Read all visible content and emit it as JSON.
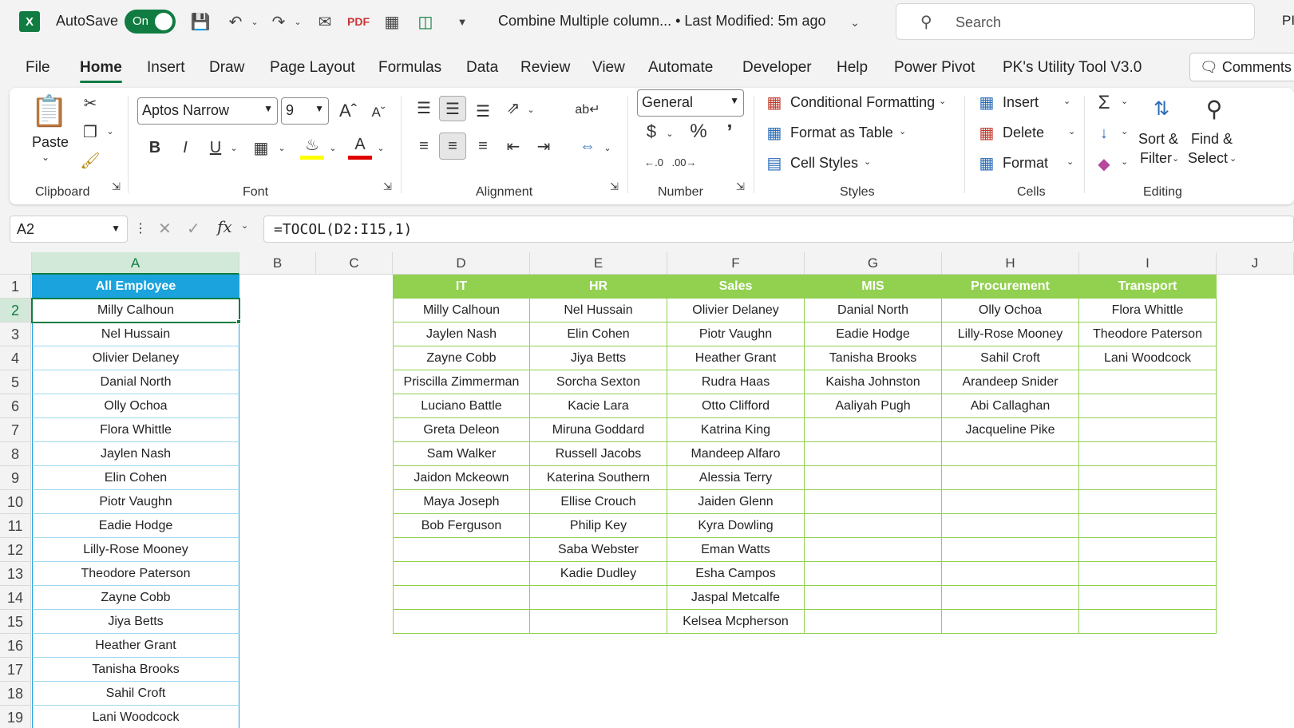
{
  "titlebar": {
    "autosave_label": "AutoSave",
    "autosave_state": "On",
    "doc_title": "Combine Multiple column...  •  Last Modified: 5m ago",
    "search_placeholder": "Search",
    "user_initials": "PI"
  },
  "tabs": [
    "File",
    "Home",
    "Insert",
    "Draw",
    "Page Layout",
    "Formulas",
    "Data",
    "Review",
    "View",
    "Automate",
    "Developer",
    "Help",
    "Power Pivot",
    "PK's Utility Tool V3.0"
  ],
  "active_tab": "Home",
  "comments_label": "Comments",
  "ribbon": {
    "clipboard": {
      "label": "Clipboard",
      "paste": "Paste"
    },
    "font": {
      "label": "Font",
      "name": "Aptos Narrow",
      "size": "9"
    },
    "alignment": {
      "label": "Alignment"
    },
    "number": {
      "label": "Number",
      "format": "General"
    },
    "styles": {
      "label": "Styles",
      "conditional": "Conditional Formatting",
      "format_table": "Format as Table",
      "cell_styles": "Cell Styles"
    },
    "cells": {
      "label": "Cells",
      "insert": "Insert",
      "delete": "Delete",
      "format": "Format"
    },
    "editing": {
      "label": "Editing",
      "sort1": "Sort &",
      "sort2": "Filter",
      "find1": "Find &",
      "find2": "Select"
    }
  },
  "formula_bar": {
    "name_box": "A2",
    "formula": "=TOCOL(D2:I15,1)"
  },
  "columns": [
    "A",
    "B",
    "C",
    "D",
    "E",
    "F",
    "G",
    "H",
    "I",
    "J"
  ],
  "rows": [
    "1",
    "2",
    "3",
    "4",
    "5",
    "6",
    "7",
    "8",
    "9",
    "10",
    "11",
    "12",
    "13",
    "14",
    "15",
    "16",
    "17",
    "18",
    "19"
  ],
  "all_employee": {
    "header": "All Employee",
    "values": [
      "Milly Calhoun",
      "Nel Hussain",
      "Olivier Delaney",
      "Danial North",
      "Olly Ochoa",
      "Flora Whittle",
      "Jaylen Nash",
      "Elin Cohen",
      "Piotr Vaughn",
      "Eadie Hodge",
      "Lilly-Rose Mooney",
      "Theodore Paterson",
      "Zayne Cobb",
      "Jiya Betts",
      "Heather Grant",
      "Tanisha Brooks",
      "Sahil Croft",
      "Lani Woodcock"
    ]
  },
  "dept_table": {
    "headers": [
      "IT",
      "HR",
      "Sales",
      "MIS",
      "Procurement",
      "Transport"
    ],
    "rows": [
      [
        "Milly Calhoun",
        "Nel Hussain",
        "Olivier Delaney",
        "Danial North",
        "Olly Ochoa",
        "Flora Whittle"
      ],
      [
        "Jaylen Nash",
        "Elin Cohen",
        "Piotr Vaughn",
        "Eadie Hodge",
        "Lilly-Rose Mooney",
        "Theodore Paterson"
      ],
      [
        "Zayne Cobb",
        "Jiya Betts",
        "Heather Grant",
        "Tanisha Brooks",
        "Sahil Croft",
        "Lani Woodcock"
      ],
      [
        "Priscilla Zimmerman",
        "Sorcha Sexton",
        "Rudra Haas",
        "Kaisha Johnston",
        "Arandeep Snider",
        ""
      ],
      [
        "Luciano Battle",
        "Kacie Lara",
        "Otto Clifford",
        "Aaliyah Pugh",
        "Abi Callaghan",
        ""
      ],
      [
        "Greta Deleon",
        "Miruna Goddard",
        "Katrina King",
        "",
        "Jacqueline Pike",
        ""
      ],
      [
        "Sam Walker",
        "Russell Jacobs",
        "Mandeep Alfaro",
        "",
        "",
        ""
      ],
      [
        "Jaidon Mckeown",
        "Katerina Southern",
        "Alessia Terry",
        "",
        "",
        ""
      ],
      [
        "Maya Joseph",
        "Ellise Crouch",
        "Jaiden Glenn",
        "",
        "",
        ""
      ],
      [
        "Bob Ferguson",
        "Philip Key",
        "Kyra Dowling",
        "",
        "",
        ""
      ],
      [
        "",
        "Saba Webster",
        "Eman Watts",
        "",
        "",
        ""
      ],
      [
        "",
        "Kadie Dudley",
        "Esha Campos",
        "",
        "",
        ""
      ],
      [
        "",
        "",
        "Jaspal Metcalfe",
        "",
        "",
        ""
      ],
      [
        "",
        "",
        "Kelsea Mcpherson",
        "",
        "",
        ""
      ]
    ]
  },
  "colors": {
    "excel_green": "#107c41",
    "all_employee_header": "#1aa3dd",
    "dept_header": "#92d050"
  }
}
